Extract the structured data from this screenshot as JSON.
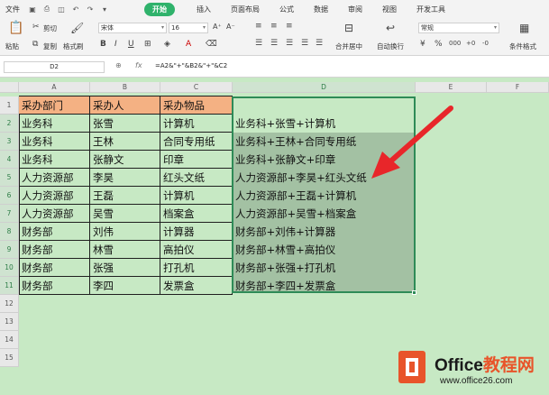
{
  "menu": {
    "file": "文件",
    "tabs": [
      "开始",
      "插入",
      "页面布局",
      "公式",
      "数据",
      "审阅",
      "视图",
      "开发工具"
    ]
  },
  "toolbar": {
    "paste": "粘贴",
    "cut": "剪切",
    "copy": "复制",
    "format_painter": "格式刷",
    "font_name": "宋体",
    "font_size": "16",
    "merge_center": "合并居中",
    "wrap_text": "自动换行",
    "number_format": "常规",
    "conditional_format": "条件格式"
  },
  "formula_bar": {
    "cell_ref": "D2",
    "fx": "fx",
    "formula": "=A2&\"+\"&B2&\"+\"&C2"
  },
  "columns": [
    "A",
    "B",
    "C",
    "D",
    "E",
    "F"
  ],
  "rows": [
    "1",
    "2",
    "3",
    "4",
    "5",
    "6",
    "7",
    "8",
    "9",
    "10",
    "11",
    "12",
    "13",
    "14",
    "15"
  ],
  "table": {
    "headers": [
      "采办部门",
      "采办人",
      "采办物品"
    ],
    "data": [
      [
        "业务科",
        "张雪",
        "计算机"
      ],
      [
        "业务科",
        "王林",
        "合同专用纸"
      ],
      [
        "业务科",
        "张静文",
        "印章"
      ],
      [
        "人力资源部",
        "李昊",
        "红头文纸"
      ],
      [
        "人力资源部",
        "王磊",
        "计算机"
      ],
      [
        "人力资源部",
        "吴雪",
        "档案盒"
      ],
      [
        "财务部",
        "刘伟",
        "计算器"
      ],
      [
        "财务部",
        "林雪",
        "高拍仪"
      ],
      [
        "财务部",
        "张强",
        "打孔机"
      ],
      [
        "财务部",
        "李四",
        "发票盒"
      ]
    ],
    "results": [
      "业务科+张雪+计算机",
      "业务科+王林+合同专用纸",
      "业务科+张静文+印章",
      "人力资源部+李昊+红头文纸",
      "人力资源部+王磊+计算机",
      "人力资源部+吴雪+档案盒",
      "财务部+刘伟+计算器",
      "财务部+林雪+高拍仪",
      "财务部+张强+打孔机",
      "财务部+李四+发票盒"
    ]
  },
  "watermark": {
    "brand_office": "Office",
    "brand_cn": "教程网",
    "url": "www.office26.com"
  },
  "colors": {
    "header_fill": "#f4b183",
    "sheet_bg": "#c7e9c4",
    "arrow": "#e8262a",
    "accent": "#2fb26b"
  }
}
